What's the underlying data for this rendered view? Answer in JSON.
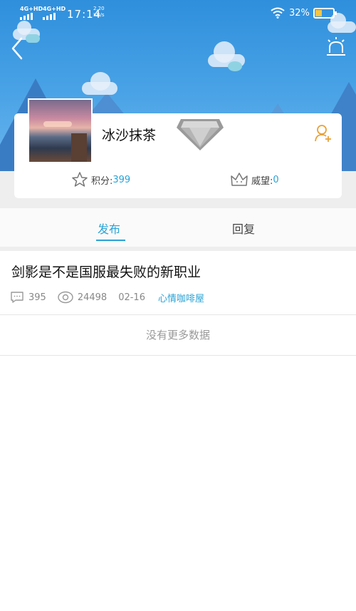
{
  "status_bar": {
    "signal1": "4G+HD",
    "signal2": "4G+HD",
    "time": "17:14",
    "speed_value": "2.20",
    "speed_unit": "KB/s",
    "battery": "32%"
  },
  "profile": {
    "username": "冰沙抹茶",
    "points_label": "积分:",
    "points_value": "399",
    "prestige_label": "威望:",
    "prestige_value": "0"
  },
  "tabs": [
    {
      "label": "发布",
      "active": true
    },
    {
      "label": "回复",
      "active": false
    }
  ],
  "posts": [
    {
      "title": "剑影是不是国服最失败的新职业",
      "replies": "395",
      "views": "24498",
      "date": "02-16",
      "category": "心情咖啡屋"
    }
  ],
  "no_more_text": "没有更多数据",
  "colors": {
    "accent": "#2aa3d6",
    "header": "#3a96de",
    "add_user_icon": "#e8a23a"
  },
  "icons": [
    "back-icon",
    "alarm-icon",
    "diamond-badge-icon",
    "add-user-icon",
    "star-icon",
    "crown-icon",
    "comment-icon",
    "eye-icon"
  ]
}
